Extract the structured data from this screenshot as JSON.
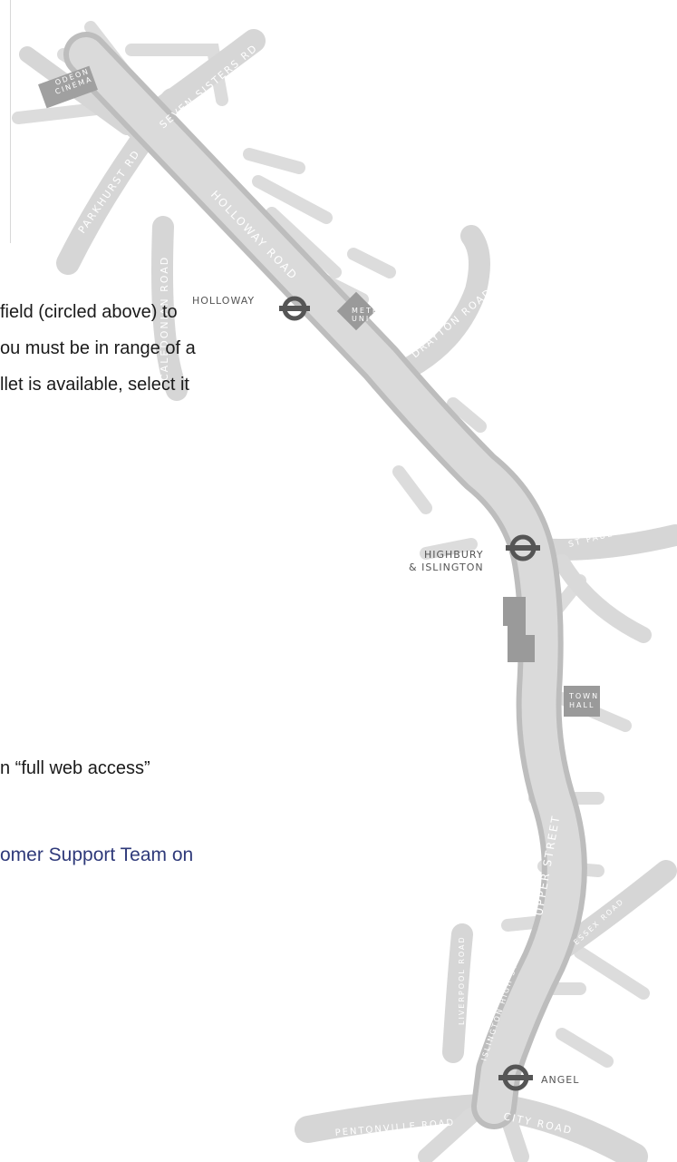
{
  "body_text": {
    "line1": "field (circled above) to",
    "line2": "ou must be in range of a",
    "line3": "llet is available, select it",
    "line4": "n “full web access”",
    "link_line": "omer Support Team on"
  },
  "map": {
    "labels": {
      "odeon_cinema_1": "ODEON",
      "odeon_cinema_2": "CINEMA",
      "seven_sisters_rd": "SEVEN SISTERS RD",
      "parkhurst_rd": "PARKHURST RD",
      "caledonian_road": "CALEDONIAN ROAD",
      "holloway_road": "HOLLOWAY ROAD",
      "holloway_station": "HOLLOWAY",
      "metropolitan_univ_1": "METROP",
      "metropolitan_univ_2": "UNIVERS",
      "drayton_road": "DRAYTON ROAD",
      "highbury_1": "HIGHBURY",
      "highbury_2": "& ISLINGTON",
      "st_pauls_rd": "ST PAUL'S RD",
      "upper_street": "UPPER STREET",
      "town_hall_1": "TOWN",
      "town_hall_2": "HALL",
      "essex_road": "ESSEX ROAD",
      "liverpool_road": "LIVERPOOL ROAD",
      "islington_high_street": "ISLINGTON HIGH STREET",
      "angel": "ANGEL",
      "pentonville_road": "PENTONVILLE ROAD",
      "city_road": "CITY ROAD"
    },
    "colors": {
      "road": "#d4d4d4",
      "road_edge": "#bdbdbd",
      "label": "#ffffff",
      "underground": "#555555",
      "block": "#9a9a9a"
    }
  }
}
